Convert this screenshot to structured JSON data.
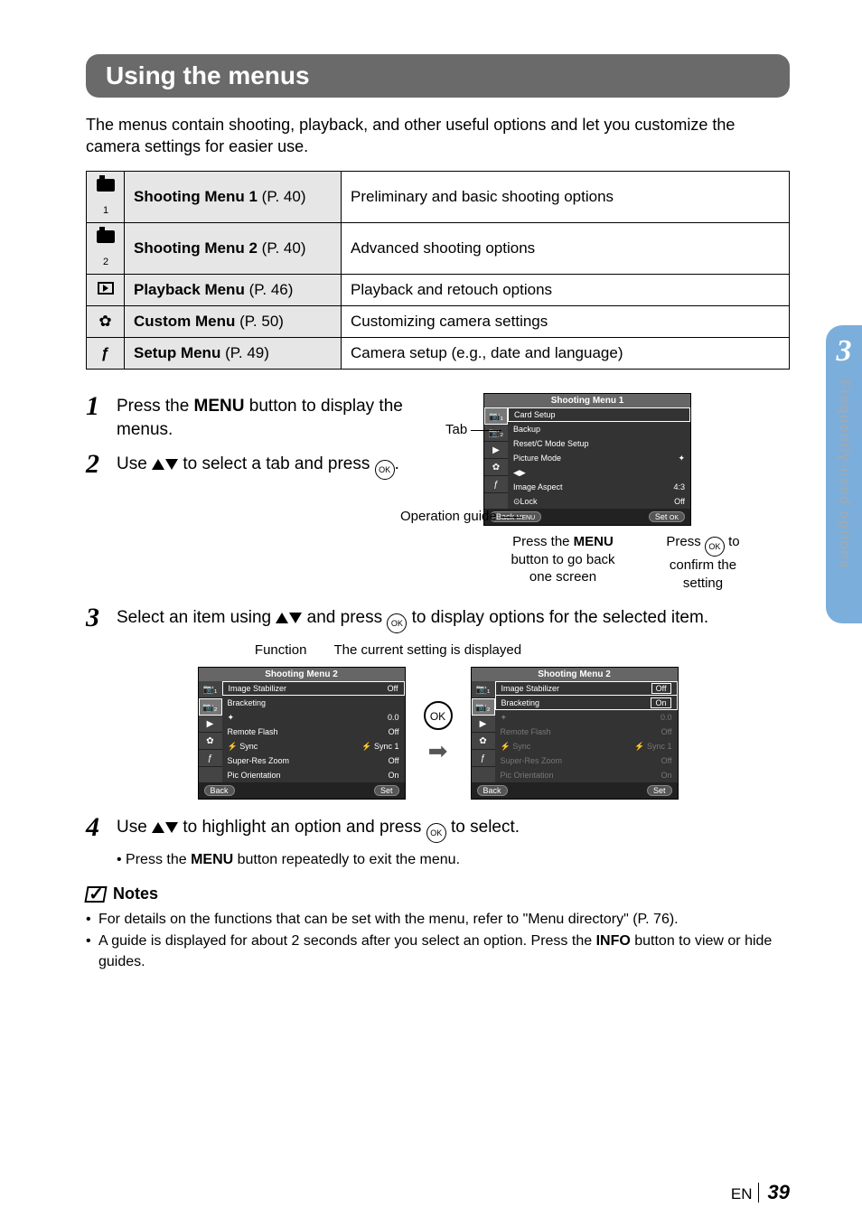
{
  "title": "Using the menus",
  "intro": "The menus contain shooting, playback, and other useful options and let you customize the camera settings for easier use.",
  "menu_table": [
    {
      "icon": "camera1",
      "name": "Shooting Menu 1",
      "page": "(P. 40)",
      "desc": "Preliminary and basic shooting options"
    },
    {
      "icon": "camera2",
      "name": "Shooting Menu 2",
      "page": "(P. 40)",
      "desc": "Advanced shooting options"
    },
    {
      "icon": "play",
      "name": "Playback Menu",
      "page": "(P. 46)",
      "desc": "Playback and retouch options"
    },
    {
      "icon": "gear",
      "name": "Custom Menu",
      "page": "(P. 50)",
      "desc": "Customizing camera settings"
    },
    {
      "icon": "wrench",
      "name": "Setup Menu",
      "page": "(P. 49)",
      "desc": "Camera setup (e.g., date and language)"
    }
  ],
  "steps": {
    "s1": {
      "num": "1",
      "pre": "Press the ",
      "btn": "MENU",
      "post": " button to display the menus."
    },
    "s2": {
      "num": "2",
      "pre": "Use ",
      "post": " to select a tab and press "
    },
    "s3": {
      "num": "3",
      "pre": "Select an item using ",
      "mid": " and press ",
      "post": " to display options for the selected item."
    },
    "s4": {
      "num": "4",
      "pre": "Use ",
      "mid": " to highlight an option and press ",
      "post": " to select.",
      "sub": "Press the MENU button repeatedly to exit the menu."
    }
  },
  "screen1": {
    "title": "Shooting Menu 1",
    "rows": [
      {
        "l": "Card Setup",
        "r": ""
      },
      {
        "l": "Backup",
        "r": ""
      },
      {
        "l": "Reset/C Mode Setup",
        "r": ""
      },
      {
        "l": "Picture Mode",
        "r": "✦"
      },
      {
        "l": "◀▶",
        "r": ""
      },
      {
        "l": "Image Aspect",
        "r": "4:3"
      },
      {
        "l": "⊙Lock",
        "r": "Off"
      }
    ],
    "back": "Back",
    "set": "Set",
    "tab_label": "Tab",
    "guide_label": "Operation guide",
    "cap_left_1": "Press the ",
    "cap_left_btn": "MENU",
    "cap_left_2": " button to go back one screen",
    "cap_right_1": "Press ",
    "cap_right_2": " to confirm the setting"
  },
  "step3_labels": {
    "fn": "Function",
    "cur": "The current setting is displayed"
  },
  "screen2": {
    "title": "Shooting Menu 2",
    "rows": [
      {
        "l": "Image Stabilizer",
        "r": "Off"
      },
      {
        "l": "Bracketing",
        "r": ""
      },
      {
        "l": "✦",
        "r": "0.0"
      },
      {
        "l": "Remote Flash",
        "r": "Off"
      },
      {
        "l": "⚡ Sync",
        "r": "⚡ Sync 1"
      },
      {
        "l": "Super-Res Zoom",
        "r": "Off"
      },
      {
        "l": "Pic Orientation",
        "r": "On"
      }
    ],
    "back": "Back",
    "set": "Set"
  },
  "screen3": {
    "title": "Shooting Menu 2",
    "rows": [
      {
        "l": "Image Stabilizer",
        "r": "Off"
      },
      {
        "l": "Bracketing",
        "r": "On"
      },
      {
        "l": "✦",
        "r": "0.0"
      },
      {
        "l": "Remote Flash",
        "r": "Off"
      },
      {
        "l": "⚡ Sync",
        "r": "⚡ Sync 1"
      },
      {
        "l": "Super-Res Zoom",
        "r": "Off"
      },
      {
        "l": "Pic Orientation",
        "r": "On"
      }
    ],
    "back": "Back",
    "set": "Set"
  },
  "notes": {
    "head": "Notes",
    "items": [
      "For details on the functions that can be set with the menu, refer to \"Menu directory\" (P. 76).",
      "A guide is displayed for about 2 seconds after you select an option. Press the INFO button to view or hide guides."
    ]
  },
  "sidetab": {
    "num": "3",
    "text": "Frequently-used options"
  },
  "footer": {
    "lang": "EN",
    "page": "39"
  }
}
